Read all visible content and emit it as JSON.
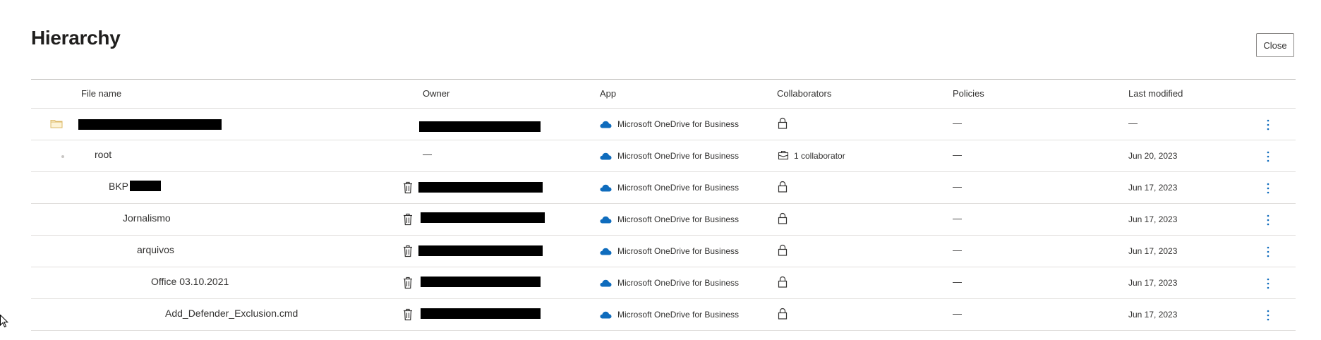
{
  "page": {
    "title": "Hierarchy",
    "close_label": "Close"
  },
  "table": {
    "headers": {
      "file_name": "File name",
      "owner": "Owner",
      "app": "App",
      "collaborators": "Collaborators",
      "policies": "Policies",
      "last_modified": "Last modified"
    },
    "rows": [
      {
        "name": "",
        "owner": "",
        "app": "Microsoft OneDrive for Business",
        "collaborators": "",
        "policies": "—",
        "last_modified": "—",
        "icon": "folder-icon"
      },
      {
        "name": "root",
        "owner": "—",
        "app": "Microsoft OneDrive for Business",
        "collaborators": "1 collaborator",
        "policies": "—",
        "last_modified": "Jun 20, 2023",
        "icon": "collaborator-icon"
      },
      {
        "name": "BKP",
        "owner": "",
        "app": "Microsoft OneDrive for Business",
        "collaborators": "",
        "policies": "—",
        "last_modified": "Jun 17, 2023",
        "icon": "trash-icon"
      },
      {
        "name": "Jornalismo",
        "owner": "",
        "app": "Microsoft OneDrive for Business",
        "collaborators": "",
        "policies": "—",
        "last_modified": "Jun 17, 2023",
        "icon": "trash-icon"
      },
      {
        "name": "arquivos",
        "owner": "",
        "app": "Microsoft OneDrive for Business",
        "collaborators": "",
        "policies": "—",
        "last_modified": "Jun 17, 2023",
        "icon": "trash-icon"
      },
      {
        "name": "Office 03.10.2021",
        "owner": "",
        "app": "Microsoft OneDrive for Business",
        "collaborators": "",
        "policies": "—",
        "last_modified": "Jun 17, 2023",
        "icon": "trash-icon"
      },
      {
        "name": "Add_Defender_Exclusion.cmd",
        "owner": "",
        "app": "Microsoft OneDrive for Business",
        "collaborators": "",
        "policies": "—",
        "last_modified": "Jun 17, 2023",
        "icon": "trash-icon"
      }
    ]
  },
  "colors": {
    "onedrive_blue": "#0f6cbd",
    "folder_yellow": "#dcb866",
    "more_blue": "#0f6cbd",
    "redaction": "#000000"
  }
}
